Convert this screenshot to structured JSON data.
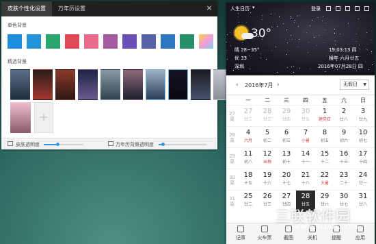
{
  "skin_panel": {
    "tabs": [
      {
        "label": "皮肤个性化设置"
      },
      {
        "label": "万年历设置"
      }
    ],
    "close_label": "×",
    "solid_title": "单色背景",
    "swatches": [
      "#1f8fdd",
      "#2394d8",
      "#2ba56f",
      "#e04a56",
      "#e86a8c",
      "#a55ba0",
      "#6a4fb8",
      "#5763a7",
      "#2f76c1",
      "#259068",
      "#f5a623"
    ],
    "featured_title": "精选背景",
    "thumbs": [
      {
        "colors": [
          "#5d6e88",
          "#1f2d3d"
        ]
      },
      {
        "colors": [
          "#2a1a1a",
          "#a3382e"
        ]
      },
      {
        "colors": [
          "#8a3a2a",
          "#2e1814"
        ]
      },
      {
        "colors": [
          "#1f2445",
          "#6a5a8f"
        ]
      },
      {
        "colors": [
          "#8a9aa6",
          "#30424d"
        ]
      },
      {
        "colors": [
          "#8e6a7a",
          "#1d2030"
        ]
      },
      {
        "colors": [
          "#9fb0c4",
          "#2b3f58"
        ]
      },
      {
        "colors": [
          "#151424",
          "#0a0a12"
        ]
      },
      {
        "colors": [
          "#1a1a22",
          "#46526c"
        ]
      },
      {
        "colors": [
          "#c6c8cf",
          "#8c8f98"
        ]
      }
    ],
    "thumb2_colors": [
      "#efc1cf",
      "#8a5a6a"
    ],
    "add_label": "+",
    "skin_opacity_label": "皮肤透明度",
    "cal_opacity_label": "万年历背景透明度",
    "skin_opacity": 0.35,
    "cal_opacity": 0.08
  },
  "calendar": {
    "app_title": "人生日历",
    "login": "登录",
    "weather": {
      "temp": "30°",
      "condition": "晴 28~35°",
      "aqi": "优 33",
      "city": "深圳"
    },
    "time": "19:03:13 四",
    "lunar": "猴年 六月廿五",
    "date": "2016年07月28日 四",
    "month_label": "2016年7月",
    "holiday_select": "无假日",
    "weekdays": [
      "一",
      "二",
      "三",
      "四",
      "五",
      "六",
      "日"
    ],
    "weeks": [
      {
        "wk": "27\n周",
        "days": [
          [
            "27",
            "廿二",
            true
          ],
          [
            "28",
            "廿三",
            true
          ],
          [
            "29",
            "廿四",
            true
          ],
          [
            "30",
            "廿五",
            true
          ],
          [
            "1",
            "建党日",
            false
          ],
          [
            "2",
            "廿八",
            false
          ],
          [
            "3",
            "廿九",
            false
          ]
        ]
      },
      {
        "wk": "28\n周",
        "days": [
          [
            "4",
            "六月",
            false
          ],
          [
            "5",
            "初二",
            false
          ],
          [
            "6",
            "初三",
            false
          ],
          [
            "7",
            "小暑",
            false
          ],
          [
            "8",
            "初五",
            false
          ],
          [
            "9",
            "初六",
            false
          ],
          [
            "10",
            "初七",
            false
          ]
        ]
      },
      {
        "wk": "29\n周",
        "days": [
          [
            "11",
            "初八",
            false
          ],
          [
            "12",
            "出梅",
            false
          ],
          [
            "13",
            "初十",
            false
          ],
          [
            "14",
            "十一",
            false
          ],
          [
            "15",
            "十二",
            false
          ],
          [
            "16",
            "十三",
            false
          ],
          [
            "17",
            "十四",
            false
          ]
        ]
      },
      {
        "wk": "30\n周",
        "days": [
          [
            "18",
            "十五",
            false
          ],
          [
            "19",
            "十六",
            false
          ],
          [
            "20",
            "十七",
            false
          ],
          [
            "21",
            "十八",
            false
          ],
          [
            "22",
            "大暑",
            false
          ],
          [
            "23",
            "二十",
            false
          ],
          [
            "24",
            "廿一",
            false
          ]
        ]
      },
      {
        "wk": "31\n周",
        "days": [
          [
            "25",
            "廿二",
            false
          ],
          [
            "26",
            "廿三",
            false
          ],
          [
            "27",
            "廿四",
            false
          ],
          [
            "28",
            "廿五",
            false
          ],
          [
            "29",
            "廿六",
            false
          ],
          [
            "30",
            "廿七",
            false
          ],
          [
            "31",
            "廿八",
            false
          ]
        ]
      }
    ],
    "today": "28",
    "footer": [
      "记事",
      "火车票",
      "截图",
      "关机",
      "提醒",
      "应用"
    ]
  },
  "watermark": {
    "text": "三联软件园",
    "sub": "www.3LIAN.COM"
  }
}
